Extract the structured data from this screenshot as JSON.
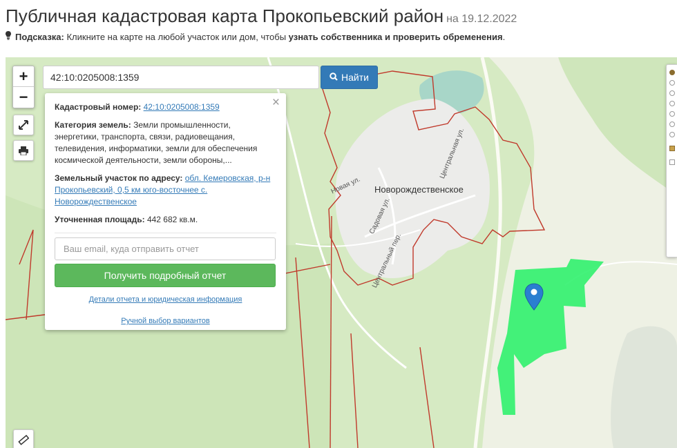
{
  "header": {
    "title": "Публичная кадастровая карта Прокопьевский район",
    "date": "на 19.12.2022"
  },
  "hint": {
    "label": "Подсказка:",
    "text_before": "Кликните на карте на любой участок или дом, чтобы",
    "text_bold": "узнать собственника и проверить обременения",
    "text_after": "."
  },
  "map": {
    "zoom_in": "+",
    "zoom_out": "−",
    "search_value": "42:10:0205008:1359",
    "search_button": "Найти",
    "town_label": "Новорождественское",
    "streets": [
      "Новая ул.",
      "Садовая ул.",
      "Центральная ул.",
      "Центральный пер."
    ]
  },
  "popup": {
    "close": "×",
    "cadastral_label": "Кадастровый номер:",
    "cadastral_value": "42:10:0205008:1359",
    "category_label": "Категория земель:",
    "category_value": "Земли промышленности, энергетики, транспорта, связи, радиовещания, телевидения, информатики, земли для обеспечения космической деятельности, земли обороны,...",
    "address_label": "Земельный участок по адресу:",
    "address_value": "обл. Кемеровская, р-н Прокопьевский, 0,5 км юго-восточнее с. Новорождественское",
    "area_label": "Уточненная площадь:",
    "area_value": "442 682 кв.м.",
    "email_placeholder": "Ваш email, куда отправить отчет",
    "report_button": "Получить подробный отчет",
    "details_link": "Детали отчета и юридическая информация",
    "manual_link": "Ручной выбор вариантов"
  },
  "colors": {
    "parcel": "#2bf06a",
    "boundary": "#c0392b",
    "primary": "#337ab7",
    "success": "#5cb85c",
    "marker": "#2a7fd0"
  }
}
